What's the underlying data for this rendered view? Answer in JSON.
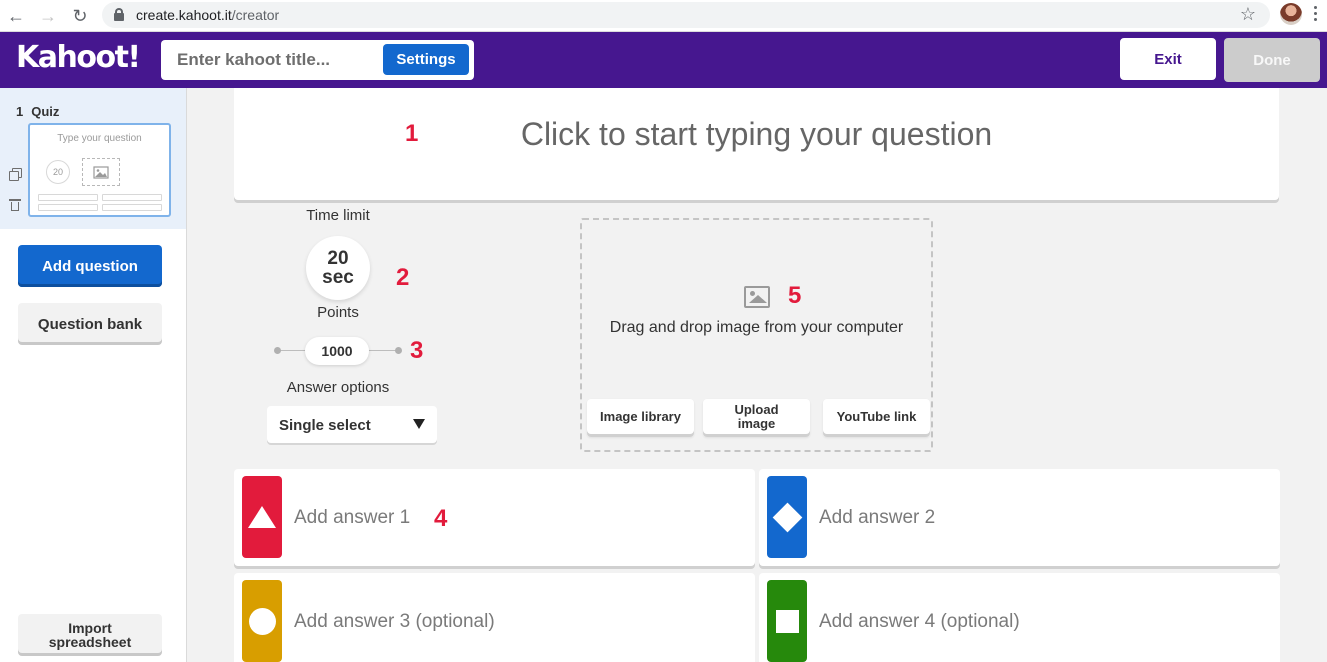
{
  "browser": {
    "url_domain": "create.kahoot.it",
    "url_path": "/creator"
  },
  "header": {
    "logo": "Kahoot!",
    "title_placeholder": "Enter kahoot title...",
    "settings_label": "Settings",
    "exit_label": "Exit",
    "done_label": "Done",
    "brand_color": "#46178f",
    "accent_color": "#1368ce"
  },
  "sidebar": {
    "slide_number": "1",
    "slide_type": "Quiz",
    "thumb_question": "Type your question",
    "thumb_timer": "20",
    "add_question_label": "Add question",
    "question_bank_label": "Question bank",
    "import_label": "Import spreadsheet"
  },
  "question": {
    "placeholder": "Click to start typing your question"
  },
  "settings": {
    "time_limit_label": "Time limit",
    "time_value": "20",
    "time_unit": "sec",
    "points_label": "Points",
    "points_value": "1000",
    "answer_options_label": "Answer options",
    "answer_option_selected": "Single select"
  },
  "media": {
    "drop_text": "Drag and drop image from your computer",
    "buttons": [
      "Image library",
      "Upload image",
      "YouTube link"
    ]
  },
  "answers": [
    {
      "label": "Add answer 1",
      "color": "#e21b3c",
      "shape": "triangle"
    },
    {
      "label": "Add answer 2",
      "color": "#1368ce",
      "shape": "diamond"
    },
    {
      "label": "Add answer 3 (optional)",
      "color": "#d89e00",
      "shape": "circle"
    },
    {
      "label": "Add answer 4 (optional)",
      "color": "#26890c",
      "shape": "square"
    }
  ],
  "annotations": [
    "1",
    "2",
    "3",
    "4",
    "5"
  ]
}
